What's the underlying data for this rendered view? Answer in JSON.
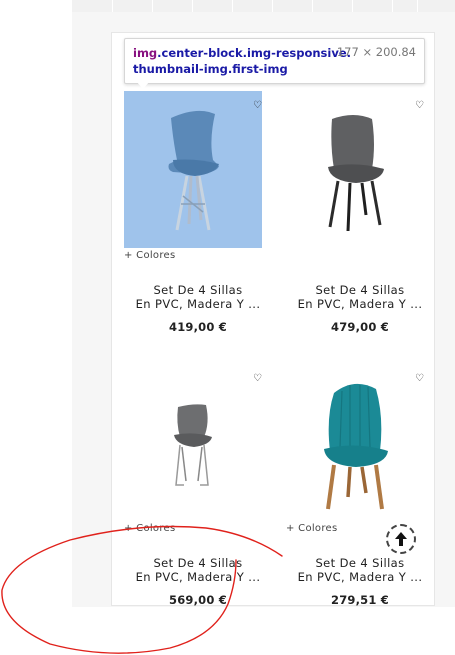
{
  "devtools_tooltip": {
    "selector_tag": "img",
    "selector_classes": ".center-block.img-responsive.thumbnail-img.first-img",
    "dimensions": "177 × 200.84"
  },
  "products": [
    {
      "colors_label": "+ Colores",
      "title_line1": "Set De 4 Sillas",
      "title_line2": "En PVC, Madera Y ...",
      "price": "419,00 €",
      "image": "blue-chair"
    },
    {
      "colors_label": "",
      "title_line1": "Set De 4 Sillas",
      "title_line2": "En PVC, Madera Y ...",
      "price": "479,00 €",
      "image": "grey-upholstered-chair"
    },
    {
      "colors_label": "+ Colores",
      "title_line1": "Set De 4 Sillas",
      "title_line2": "En PVC, Madera Y ...",
      "price": "569,00 €",
      "image": "grey-metal-chair"
    },
    {
      "colors_label": "+ Colores",
      "title_line1": "Set De 4 Sillas",
      "title_line2": "En PVC, Madera Y ...",
      "price": "279,51 €",
      "image": "teal-velvet-chair"
    }
  ],
  "icons": {
    "favorite": "heart-outline-icon",
    "scroll_top": "arrow-up-icon"
  },
  "colors": {
    "highlight": "#9fc3eb",
    "annotation": "#e0211b",
    "selector_tag": "#881280",
    "selector_class": "#1a1aa6"
  }
}
